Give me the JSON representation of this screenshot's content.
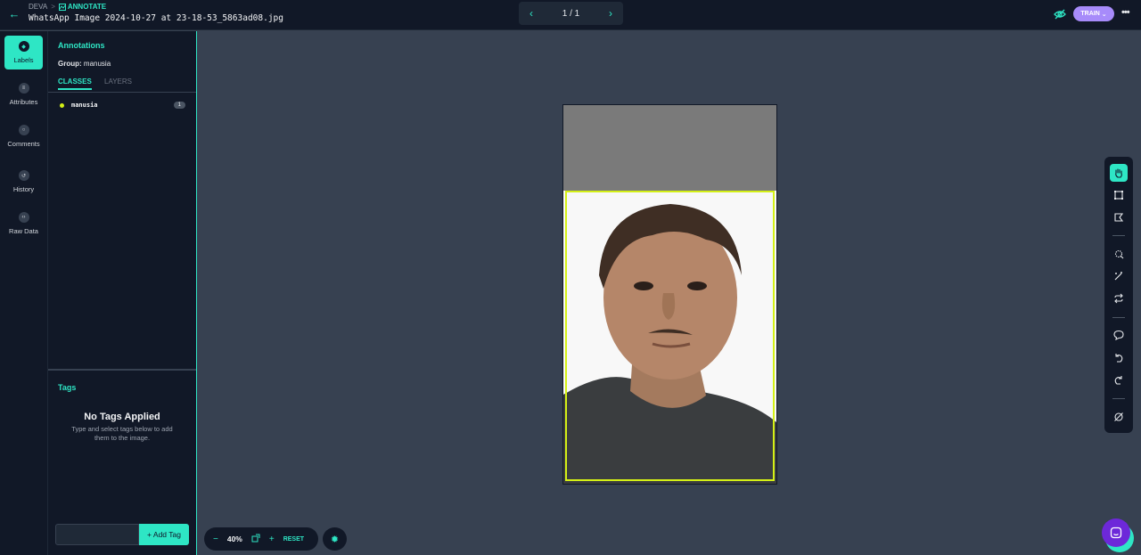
{
  "header": {
    "breadcrumb_root": "DEVA",
    "breadcrumb_sep": ">",
    "breadcrumb_current": "ANNOTATE",
    "filename": "WhatsApp Image 2024-10-27 at 23-18-53_5863ad08.jpg",
    "pager": "1 / 1",
    "train_label": "TRAIN"
  },
  "rail": {
    "items": [
      {
        "label": "Labels"
      },
      {
        "label": "Attributes"
      },
      {
        "label": "Comments"
      },
      {
        "label": "History"
      },
      {
        "label": "Raw Data"
      }
    ]
  },
  "panel": {
    "title": "Annotations",
    "group_prefix": "Group:",
    "group_value": "manusia",
    "tabs": [
      "CLASSES",
      "LAYERS"
    ],
    "classes": [
      {
        "name": "manusia",
        "count": "1",
        "color": "#d4f016"
      }
    ],
    "tags_title": "Tags",
    "no_tags_heading": "No Tags Applied",
    "no_tags_text": "Type and select tags below to add them to the image.",
    "tag_input_placeholder": "",
    "add_tag_label": "+ Add Tag"
  },
  "zoom": {
    "minus": "−",
    "value": "40%",
    "plus": "+",
    "reset": "RESET"
  },
  "colors": {
    "accent": "#2ee6c5",
    "bbox": "#d4f016",
    "train": "#a78bfa",
    "background": "#374151",
    "panel": "#111827"
  }
}
